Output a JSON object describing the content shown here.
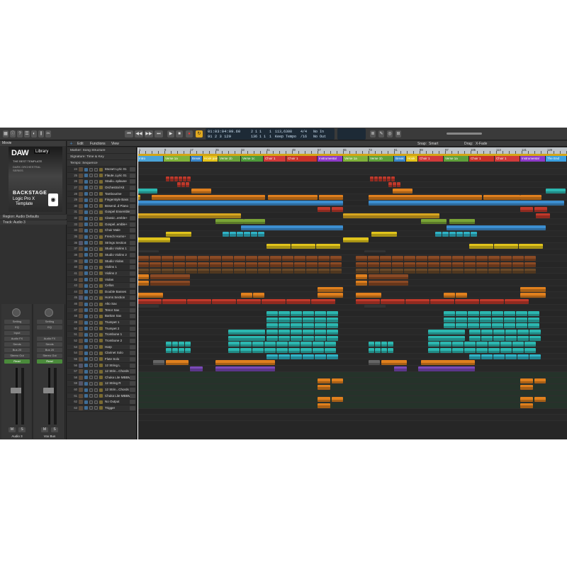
{
  "toolbar": {
    "lcd": {
      "time": "01:03:04:09.60",
      "bars": "91 2 3 129",
      "ticks_a": "2 1 1",
      "ticks_b": "136 1 1",
      "tempo": "113,6308",
      "tempo_mode": "Keep Tempo",
      "sig_top": "4/4",
      "sig_bottom": "/16",
      "in": "No In",
      "out": "No Out",
      "bar_a": "1",
      "bar_b": "1"
    }
  },
  "inspector": {
    "header": "Movie",
    "artwork": {
      "logo": "DAW",
      "logo_right": "Library",
      "sub": "THE BEST TEMPLATE",
      "series": "DARK ORCHESTRAL SERIES",
      "backstage": "BACKSTAGE",
      "product": "Logic Pro X",
      "product2": "Template"
    },
    "region_row": "Region: Audio Defaults",
    "track_row": "Track: Audio 3",
    "strips": [
      {
        "name": "Audio 3",
        "slots": [
          "Setting",
          "EQ",
          "Input",
          "Audio FX",
          "Sends",
          "Bus 20",
          "Stereo Out",
          "Read"
        ],
        "mute": "M",
        "solo": "S"
      },
      {
        "name": "Vox Bus",
        "slots": [
          "Setting",
          "EQ",
          "",
          "Audio FX",
          "Sends",
          "Bus 20",
          "Stereo Out",
          "Read"
        ],
        "mute": "M",
        "solo": "S"
      }
    ]
  },
  "track_toolbar": {
    "edit": "Edit",
    "functions": "Functions",
    "view": "View",
    "snap_label": "Snap:",
    "snap_value": "Smart",
    "drag_label": "Drag:",
    "drag_value": "X-Fade"
  },
  "global_tracks": [
    "Marker: Song Structure",
    "Signature: Time & Key",
    "Tempo: Sequence"
  ],
  "tracks": [
    {
      "num": "24",
      "name": "Mozart Lyric 01"
    },
    {
      "num": "25",
      "name": "Flaute..Lyric 01"
    },
    {
      "num": "26",
      "name": "Stadiu..splause"
    },
    {
      "num": "27",
      "name": "Orchestral Kit"
    },
    {
      "num": "28",
      "name": "Tambourine"
    },
    {
      "num": "29",
      "name": "Fingerstyle Bass"
    },
    {
      "num": "30",
      "name": "Bösend..d Piano"
    },
    {
      "num": "31",
      "name": "Gospel Ensemble"
    },
    {
      "num": "32",
      "name": "Classic..emble+"
    },
    {
      "num": "33",
      "name": "Gospel..emble+"
    },
    {
      "num": "34",
      "name": "Choir Male"
    },
    {
      "num": "35",
      "name": "French Horns+"
    },
    {
      "num": "36",
      "name": "Strings Section"
    },
    {
      "num": "37",
      "name": "Studio Violins 1"
    },
    {
      "num": "38",
      "name": "Studio Violins 2"
    },
    {
      "num": "39",
      "name": "Studio Violas"
    },
    {
      "num": "40",
      "name": "Violins 1"
    },
    {
      "num": "41",
      "name": "Violins 2"
    },
    {
      "num": "42",
      "name": "Violas"
    },
    {
      "num": "43",
      "name": "Cellos"
    },
    {
      "num": "44",
      "name": "Double Basses"
    },
    {
      "num": "45",
      "name": "Horns Section"
    },
    {
      "num": "46",
      "name": "Alto Sax"
    },
    {
      "num": "47",
      "name": "Tenor Sax"
    },
    {
      "num": "48",
      "name": "Baritan Sax"
    },
    {
      "num": "49",
      "name": "Trumpet 1"
    },
    {
      "num": "50",
      "name": "Trumpet 2"
    },
    {
      "num": "51",
      "name": "Trombone 1"
    },
    {
      "num": "52",
      "name": "Trombone 2"
    },
    {
      "num": "53",
      "name": "Harp"
    },
    {
      "num": "54",
      "name": "Clarinet Solo"
    },
    {
      "num": "55",
      "name": "Flute Solo"
    },
    {
      "num": "56",
      "name": "12 String L"
    },
    {
      "num": "57",
      "name": "12 Strin...Chords"
    },
    {
      "num": "58",
      "name": "Chuka Lite MBBM"
    },
    {
      "num": "59",
      "name": "12 String R"
    },
    {
      "num": "60",
      "name": "12 Strin...Chords"
    },
    {
      "num": "61",
      "name": "Chuka Lite MBBM"
    },
    {
      "num": "62",
      "name": "No Output"
    },
    {
      "num": "63",
      "name": "Trigger"
    }
  ],
  "ruler": [
    "1",
    "9",
    "17",
    "25",
    "33",
    "41",
    "49",
    "57",
    "65",
    "73",
    "81",
    "89",
    "97",
    "105",
    "113",
    "121",
    "129"
  ],
  "structure": [
    {
      "label": "Intro",
      "color": "#4aa3d8",
      "x": 0,
      "w": 37
    },
    {
      "label": "Verse 1a",
      "color": "#7fb23a",
      "x": 37,
      "w": 38
    },
    {
      "label": "Break",
      "color": "#3a86c8",
      "x": 75,
      "w": 17
    },
    {
      "label": "Hook part",
      "color": "#e2c21a",
      "x": 92,
      "w": 22
    },
    {
      "label": "Verse 1b",
      "color": "#6aa33a",
      "x": 114,
      "w": 32
    },
    {
      "label": "Verse 1c",
      "color": "#4d9a3a",
      "x": 146,
      "w": 32
    },
    {
      "label": "Choir 1",
      "color": "#d13a3a",
      "x": 178,
      "w": 32
    },
    {
      "label": "Choir 1",
      "color": "#c8322a",
      "x": 210,
      "w": 44
    },
    {
      "label": "Instrumental",
      "color": "#8e3ac8",
      "x": 254,
      "w": 36
    },
    {
      "label": "Verse 1a",
      "color": "#7fb23a",
      "x": 290,
      "w": 36
    },
    {
      "label": "Verse 1b",
      "color": "#5ea03a",
      "x": 326,
      "w": 36
    },
    {
      "label": "Break",
      "color": "#3a86c8",
      "x": 362,
      "w": 17
    },
    {
      "label": "Hook",
      "color": "#e2c21a",
      "x": 379,
      "w": 17
    },
    {
      "label": "Choir 1",
      "color": "#d13a3a",
      "x": 396,
      "w": 36
    },
    {
      "label": "Verse 1a",
      "color": "#5ea03a",
      "x": 432,
      "w": 36
    },
    {
      "label": "Choir 1",
      "color": "#c8322a",
      "x": 468,
      "w": 36
    },
    {
      "label": "Choir 1",
      "color": "#d13a3a",
      "x": 504,
      "w": 36
    },
    {
      "label": "Instrumental",
      "color": "#8e3ac8",
      "x": 540,
      "w": 36
    },
    {
      "label": "The End",
      "color": "#3aa0e0",
      "x": 576,
      "w": 30
    }
  ],
  "colors": {
    "red": "#c0392b",
    "brown": "#8a4a25",
    "orange": "#e0801e",
    "gold": "#d7a620",
    "green": "#7aa536",
    "blue": "#3c8ed0",
    "teal": "#2cb7b0",
    "cyan": "#2fb3c6",
    "purple": "#7a4ab8",
    "yellow": "#e1c41c"
  }
}
